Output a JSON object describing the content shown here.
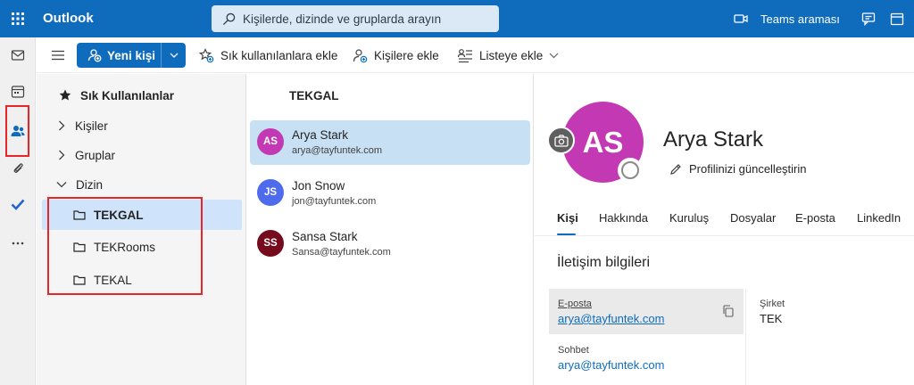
{
  "topbar": {
    "app_name": "Outlook",
    "search_placeholder": "Kişilerde, dizinde ve gruplarda arayın",
    "teams_label": "Teams araması"
  },
  "command_bar": {
    "new_contact": "Yeni kişi",
    "add_favorites": "Sık kullanılanlara ekle",
    "add_contacts": "Kişilere ekle",
    "add_list": "Listeye ekle"
  },
  "folders": {
    "favorites": "Sık Kullanılanlar",
    "contacts": "Kişiler",
    "groups": "Gruplar",
    "directory": "Dizin",
    "items": [
      "TEKGAL",
      "TEKRooms",
      "TEKAL"
    ]
  },
  "list": {
    "title": "TEKGAL",
    "people": [
      {
        "initials": "AS",
        "name": "Arya Stark",
        "email": "arya@tayfuntek.com",
        "color": "#c239b3"
      },
      {
        "initials": "JS",
        "name": "Jon Snow",
        "email": "jon@tayfuntek.com",
        "color": "#4f6bed"
      },
      {
        "initials": "SS",
        "name": "Sansa Stark",
        "email": "Sansa@tayfuntek.com",
        "color": "#750b1c"
      }
    ]
  },
  "detail": {
    "initials": "AS",
    "name": "Arya Stark",
    "update_profile": "Profilinizi güncelleştirin",
    "tabs": [
      "Kişi",
      "Hakkında",
      "Kuruluş",
      "Dosyalar",
      "E-posta",
      "LinkedIn"
    ],
    "section_title": "İletişim bilgileri",
    "email_label": "E-posta",
    "email_value": "arya@tayfuntek.com",
    "company_label": "Şirket",
    "company_value": "TEK",
    "chat_label": "Sohbet",
    "chat_value": "arya@tayfuntek.com"
  },
  "colors": {
    "brand": "#0f6cbd",
    "highlight_box": "#e8262a",
    "selected_row": "#c7e0f4"
  }
}
